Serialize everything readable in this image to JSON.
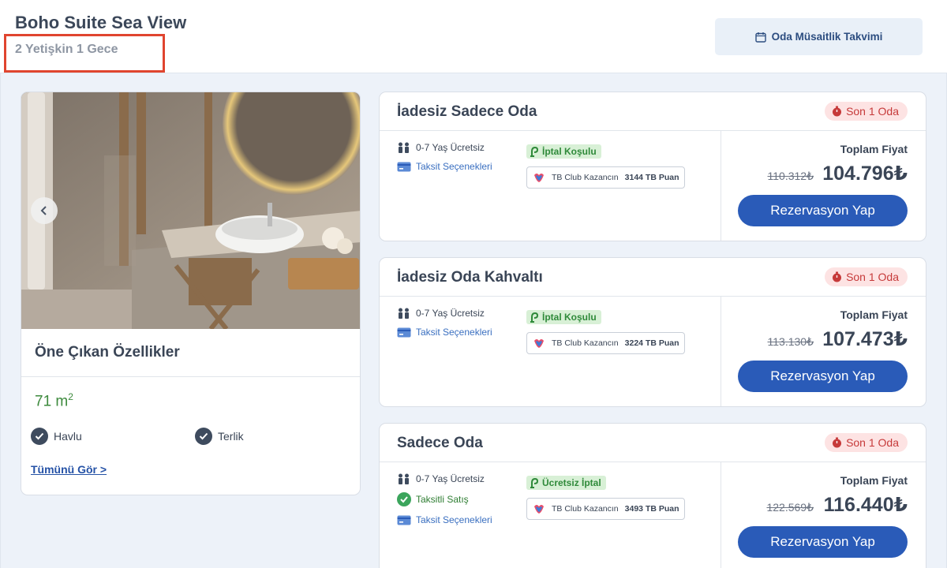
{
  "header": {
    "title": "Boho Suite Sea View",
    "subtitle": "2 Yetişkin 1 Gece",
    "calendar_label": "Oda Müsaitlik Takvimi"
  },
  "features": {
    "title": "Öne Çıkan Özellikler",
    "area_value": "71 m",
    "area_unit_sup": "2",
    "amenities": [
      "Havlu",
      "Terlik"
    ],
    "see_all": "Tümünü Gör >"
  },
  "offers": [
    {
      "title": "İadesiz Sadece Oda",
      "badge": "Son 1 Oda",
      "child_policy": "0-7 Yaş Ücretsiz",
      "installment": "Taksit Seçenekleri",
      "cancel": "İptal Koşulu",
      "club_text": "TB Club Kazancın",
      "club_points": "3144 TB Puan",
      "total_label": "Toplam Fiyat",
      "old_price": "110.312₺",
      "price": "104.796₺",
      "button": "Rezervasyon Yap"
    },
    {
      "title": "İadesiz Oda Kahvaltı",
      "badge": "Son 1 Oda",
      "child_policy": "0-7 Yaş Ücretsiz",
      "installment": "Taksit Seçenekleri",
      "cancel": "İptal Koşulu",
      "club_text": "TB Club Kazancın",
      "club_points": "3224 TB Puan",
      "total_label": "Toplam Fiyat",
      "old_price": "113.130₺",
      "price": "107.473₺",
      "button": "Rezervasyon Yap"
    },
    {
      "title": "Sadece Oda",
      "badge": "Son 1 Oda",
      "child_policy": "0-7 Yaş Ücretsiz",
      "installment_sale": "Taksitli Satış",
      "installment": "Taksit Seçenekleri",
      "cancel": "Ücretsiz İptal",
      "club_text": "TB Club Kazancın",
      "club_points": "3493 TB Puan",
      "total_label": "Toplam Fiyat",
      "old_price": "122.569₺",
      "price": "116.440₺",
      "button": "Rezervasyon Yap"
    }
  ],
  "colors": {
    "primary_button": "#2a5bb8",
    "badge_red": "#c63a3a",
    "green": "#2f8a3a",
    "highlight": "#e0452f"
  },
  "icons": {
    "calendar": "calendar-icon",
    "timer": "timer-icon",
    "family": "family-icon",
    "card": "credit-card-icon",
    "cancel": "cancel-policy-icon",
    "club": "tb-club-logo-icon",
    "check": "check-icon",
    "prev": "chevron-left-icon"
  }
}
